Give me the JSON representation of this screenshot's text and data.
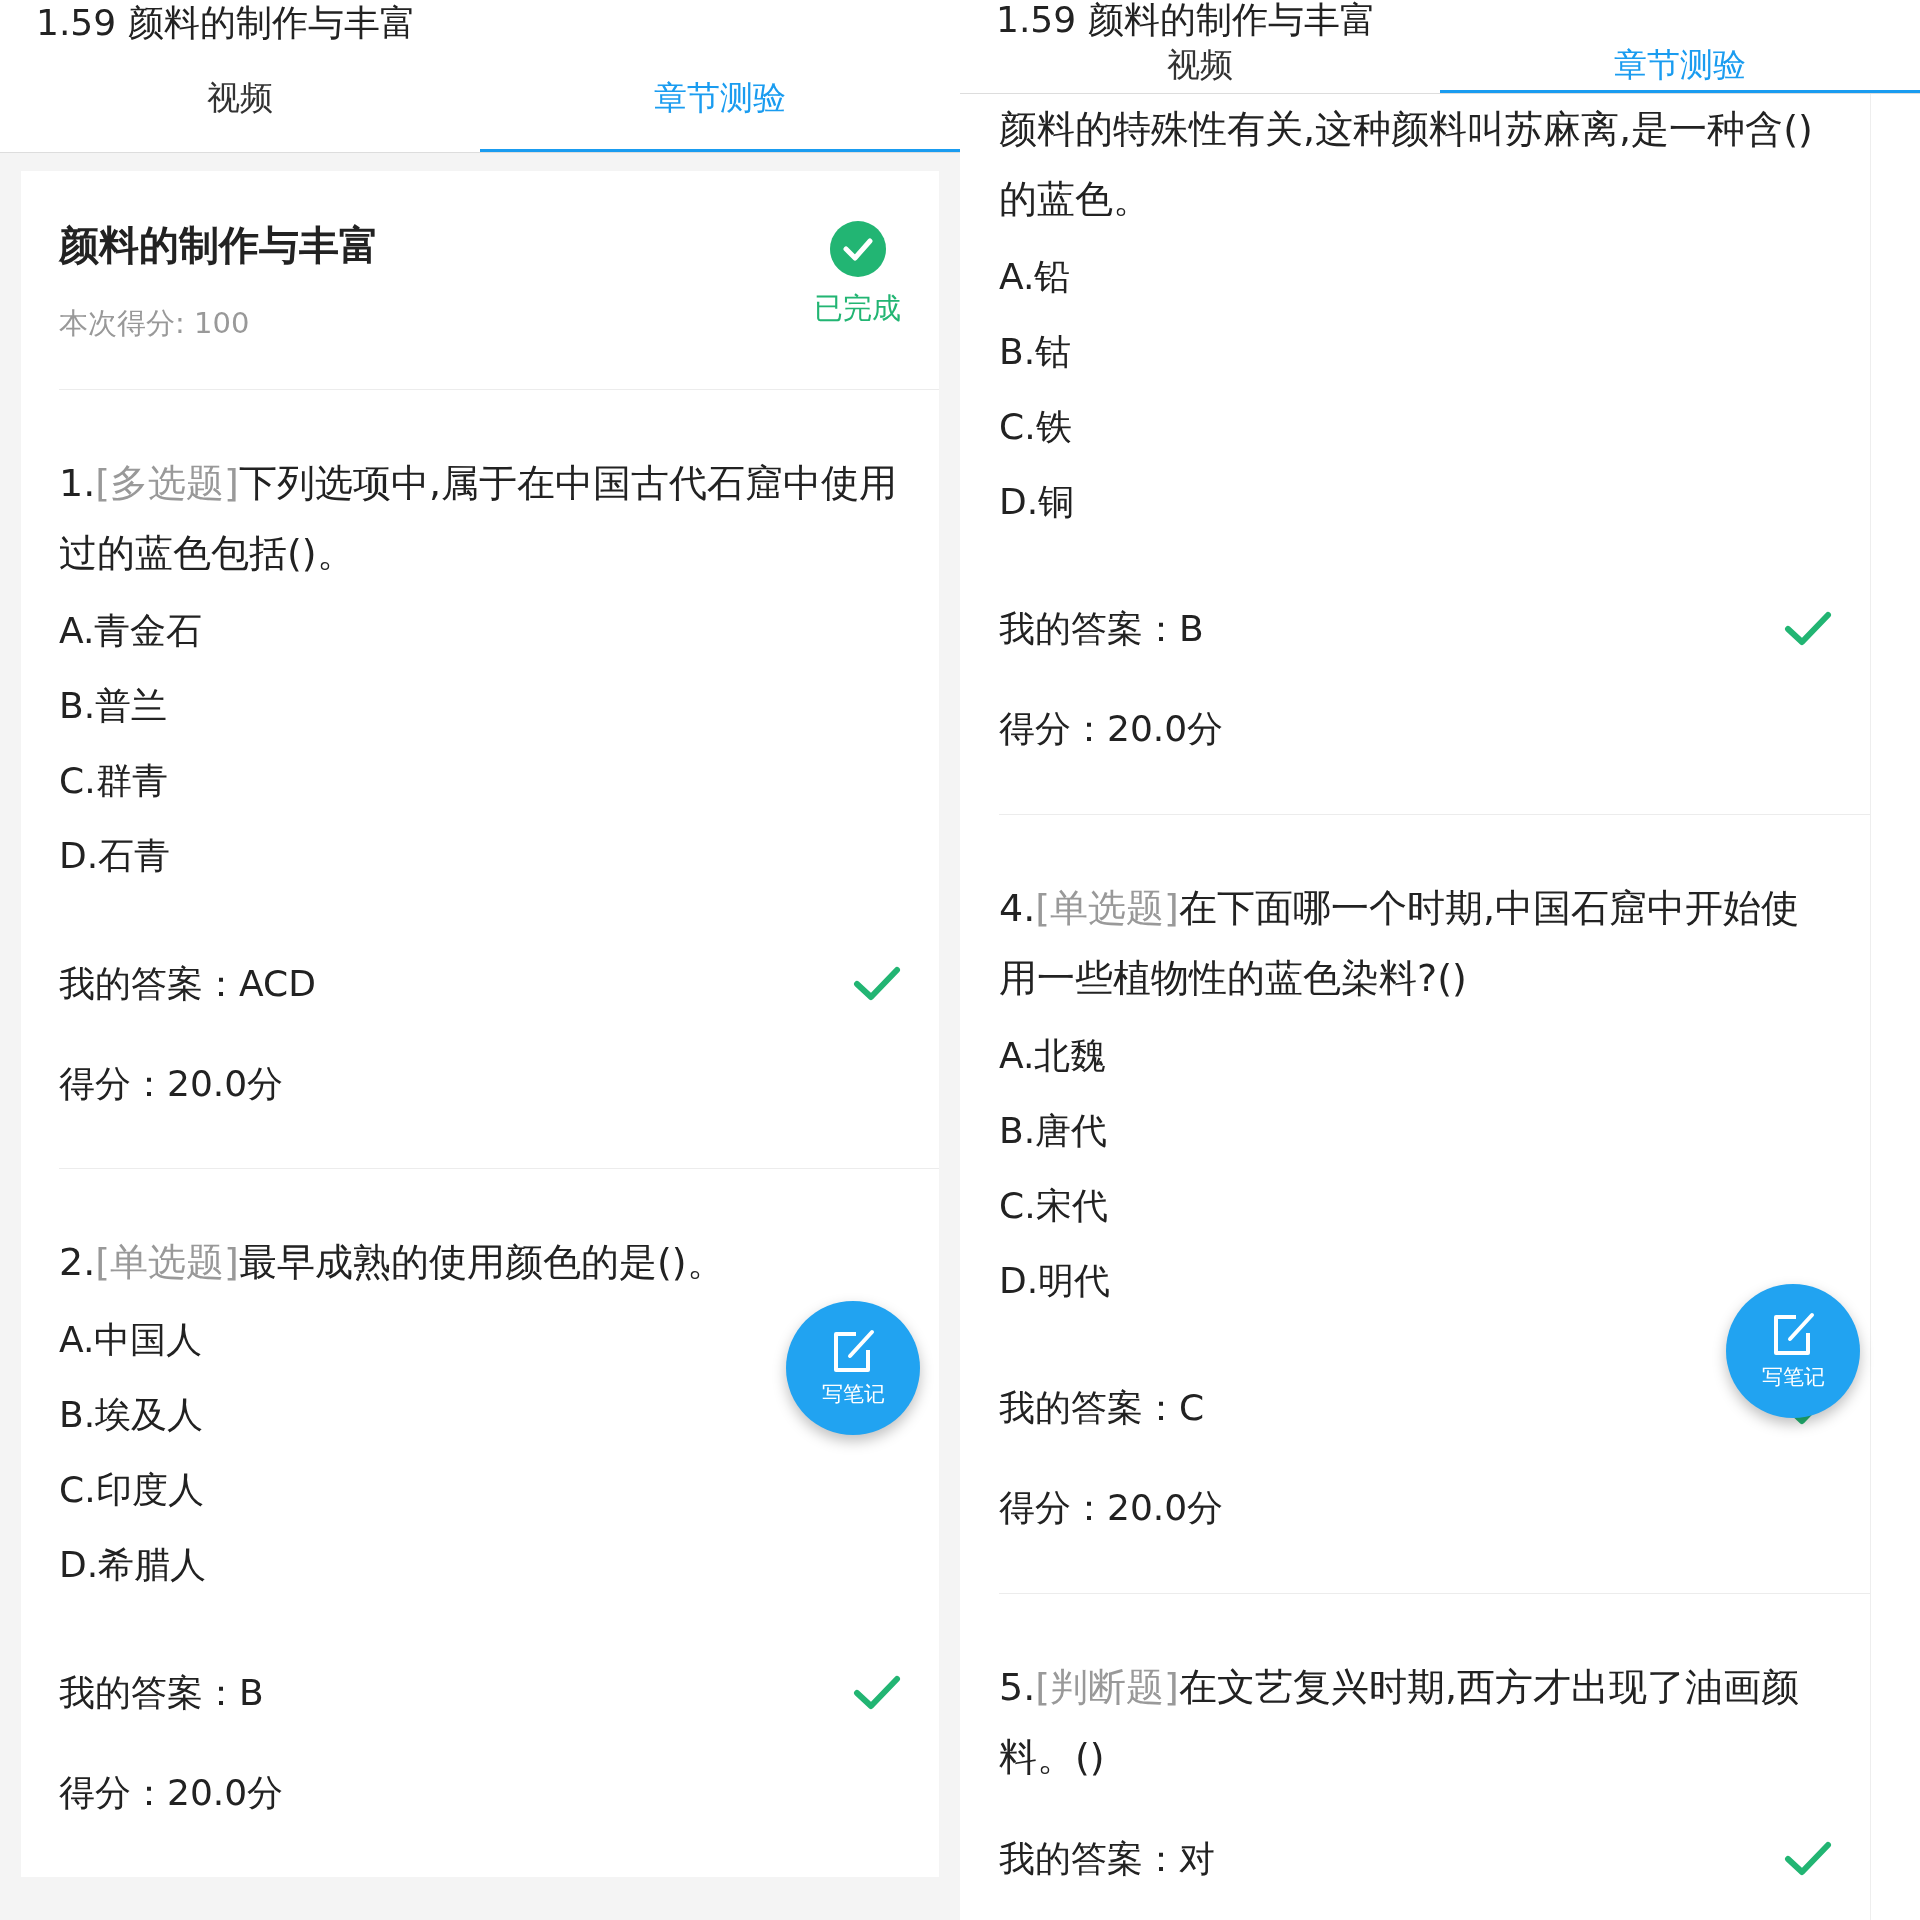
{
  "panels": [
    {
      "title": "1.59 颜料的制作与丰富",
      "tabs": [
        {
          "label": "视频",
          "selected": false
        },
        {
          "label": "章节测验",
          "selected": true
        }
      ],
      "header": {
        "title": "颜料的制作与丰富",
        "score": "本次得分: 100",
        "status": "已完成",
        "completed": true
      },
      "questions": [
        {
          "number": "1.",
          "type": "[多选题]",
          "text": "下列选项中,属于在中国古代石窟中使用过的蓝色包括()。",
          "options": [
            "A.青金石",
            "B.普兰",
            "C.群青",
            "D.石青"
          ],
          "answer": "我的答案：ACD",
          "correct": true,
          "score": "得分：20.0分"
        },
        {
          "number": "2.",
          "type": "[单选题]",
          "text": "最早成熟的使用颜色的是()。",
          "options": [
            "A.中国人",
            "B.埃及人",
            "C.印度人",
            "D.希腊人"
          ],
          "answer": "我的答案：B",
          "correct": true,
          "score": "得分：20.0分"
        }
      ],
      "note_button": {
        "label": "写笔记"
      }
    },
    {
      "title": "1.59 颜料的制作与丰富",
      "tabs": [
        {
          "label": "视频",
          "selected": false
        },
        {
          "label": "章节测验",
          "selected": true
        }
      ],
      "questions": [
        {
          "text": "颜料的特殊性有关,这种颜料叫苏麻离,是一种含()的蓝色。",
          "options": [
            "A.铅",
            "B.钴",
            "C.铁",
            "D.铜"
          ],
          "answer": "我的答案：B",
          "correct": true,
          "score": "得分：20.0分"
        },
        {
          "number": "4.",
          "type": "[单选题]",
          "text": "在下面哪一个时期,中国石窟中开始使用一些植物性的蓝色染料?()",
          "options": [
            "A.北魏",
            "B.唐代",
            "C.宋代",
            "D.明代"
          ],
          "answer": "我的答案：C",
          "correct": true,
          "score": "得分：20.0分"
        },
        {
          "number": "5.",
          "type": "[判断题]",
          "text": "在文艺复兴时期,西方才出现了油画颜料。()",
          "answer": "我的答案：对",
          "correct": true
        }
      ],
      "note_button": {
        "label": "写笔记"
      }
    }
  ]
}
